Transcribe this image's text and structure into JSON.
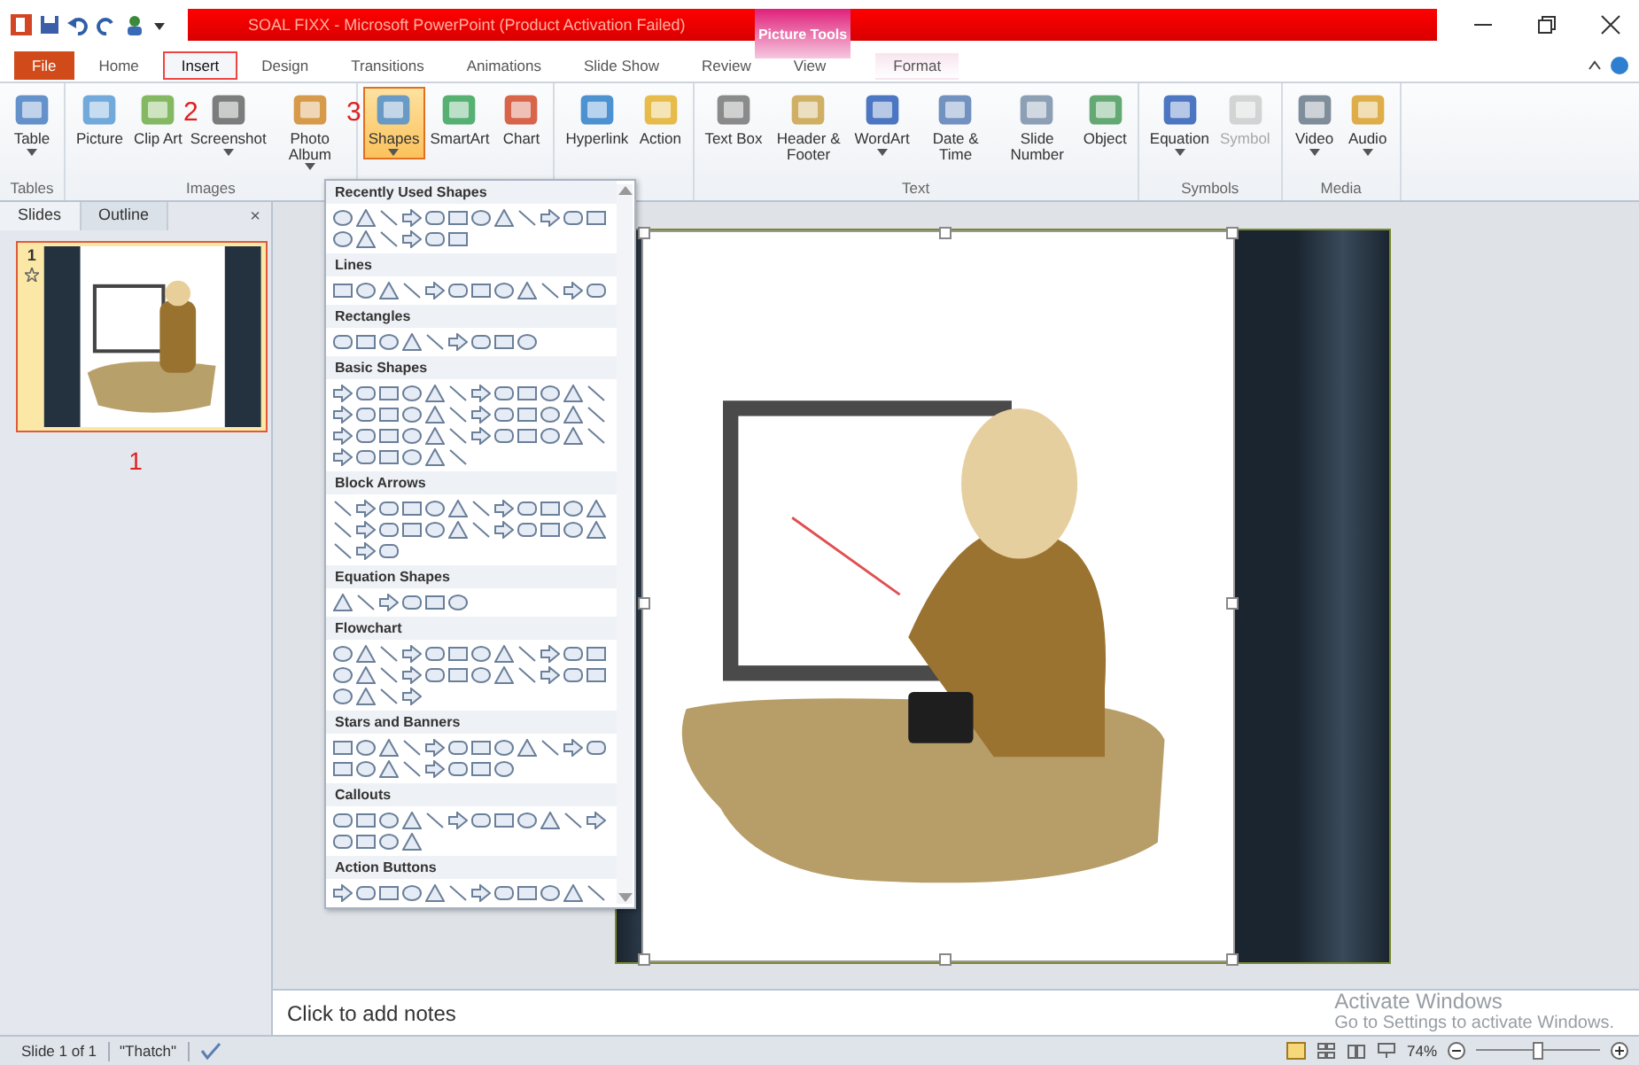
{
  "title_bar": {
    "title": "SOAL FIXX  -  Microsoft PowerPoint (Product Activation Failed)",
    "context_tab": "Picture Tools"
  },
  "tabs": [
    {
      "label": "File",
      "kind": "file",
      "selected": false,
      "annotated": false
    },
    {
      "label": "Home",
      "kind": "normal",
      "selected": false,
      "annotated": false
    },
    {
      "label": "Insert",
      "kind": "normal",
      "selected": true,
      "annotated": true
    },
    {
      "label": "Design",
      "kind": "normal",
      "selected": false,
      "annotated": false
    },
    {
      "label": "Transitions",
      "kind": "normal",
      "selected": false,
      "annotated": false
    },
    {
      "label": "Animations",
      "kind": "normal",
      "selected": false,
      "annotated": false
    },
    {
      "label": "Slide Show",
      "kind": "normal",
      "selected": false,
      "annotated": false
    },
    {
      "label": "Review",
      "kind": "normal",
      "selected": false,
      "annotated": false
    },
    {
      "label": "View",
      "kind": "normal",
      "selected": false,
      "annotated": false
    },
    {
      "label": "Format",
      "kind": "contextual",
      "selected": false,
      "annotated": false
    }
  ],
  "ribbon_groups": [
    {
      "label": "Tables",
      "buttons": [
        {
          "label": "Table",
          "dropdown": true,
          "disabled": false,
          "pressed": false
        }
      ]
    },
    {
      "label": "Images",
      "buttons": [
        {
          "label": "Picture",
          "dropdown": false,
          "disabled": false,
          "pressed": false
        },
        {
          "label": "Clip Art",
          "dropdown": false,
          "disabled": false,
          "pressed": false,
          "annotation": "2"
        },
        {
          "label": "Screenshot",
          "dropdown": true,
          "disabled": false,
          "pressed": false
        },
        {
          "label": "Photo Album",
          "dropdown": true,
          "disabled": false,
          "pressed": false,
          "annotation": "3"
        }
      ]
    },
    {
      "buttons": [
        {
          "label": "Shapes",
          "dropdown": true,
          "disabled": false,
          "pressed": true
        },
        {
          "label": "SmartArt",
          "dropdown": false,
          "disabled": false,
          "pressed": false
        },
        {
          "label": "Chart",
          "dropdown": false,
          "disabled": false,
          "pressed": false
        }
      ]
    },
    {
      "buttons": [
        {
          "label": "Hyperlink",
          "dropdown": false,
          "disabled": false,
          "pressed": false
        },
        {
          "label": "Action",
          "dropdown": false,
          "disabled": false,
          "pressed": false
        }
      ]
    },
    {
      "label": "Text",
      "buttons": [
        {
          "label": "Text Box",
          "dropdown": false,
          "disabled": false,
          "pressed": false
        },
        {
          "label": "Header & Footer",
          "dropdown": false,
          "disabled": false,
          "pressed": false
        },
        {
          "label": "WordArt",
          "dropdown": true,
          "disabled": false,
          "pressed": false
        },
        {
          "label": "Date & Time",
          "dropdown": false,
          "disabled": false,
          "pressed": false
        },
        {
          "label": "Slide Number",
          "dropdown": false,
          "disabled": false,
          "pressed": false
        },
        {
          "label": "Object",
          "dropdown": false,
          "disabled": false,
          "pressed": false
        }
      ]
    },
    {
      "label": "Symbols",
      "buttons": [
        {
          "label": "Equation",
          "dropdown": true,
          "disabled": false,
          "pressed": false
        },
        {
          "label": "Symbol",
          "dropdown": false,
          "disabled": true,
          "pressed": false
        }
      ]
    },
    {
      "label": "Media",
      "buttons": [
        {
          "label": "Video",
          "dropdown": true,
          "disabled": false,
          "pressed": false
        },
        {
          "label": "Audio",
          "dropdown": true,
          "disabled": false,
          "pressed": false
        }
      ]
    }
  ],
  "shapes_gallery": {
    "sections": [
      {
        "title": "Recently Used Shapes"
      },
      {
        "title": "Lines"
      },
      {
        "title": "Rectangles"
      },
      {
        "title": "Basic Shapes"
      },
      {
        "title": "Block Arrows"
      },
      {
        "title": "Equation Shapes"
      },
      {
        "title": "Flowchart"
      },
      {
        "title": "Stars and Banners"
      },
      {
        "title": "Callouts"
      },
      {
        "title": "Action Buttons"
      }
    ]
  },
  "side_panel": {
    "tabs": [
      {
        "label": "Slides",
        "selected": true
      },
      {
        "label": "Outline",
        "selected": false
      }
    ],
    "close": "×",
    "slides": [
      {
        "number": "1",
        "selected": true,
        "annotation": "1"
      }
    ]
  },
  "notes": {
    "placeholder": "Click to add notes"
  },
  "activation_notice": {
    "title": "Activate Windows",
    "message": "Go to Settings to activate Windows."
  },
  "status_bar": {
    "slide": "Slide 1 of 1",
    "theme": "\"Thatch\"",
    "zoom": "74%",
    "zoom_slider": {
      "level": 0.45
    }
  }
}
